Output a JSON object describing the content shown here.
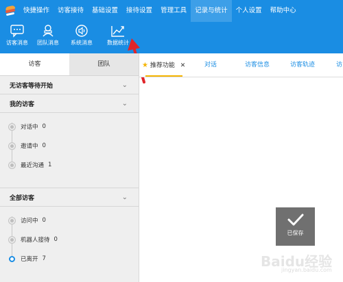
{
  "nav": {
    "items": [
      {
        "label": "快捷操作"
      },
      {
        "label": "访客接待"
      },
      {
        "label": "基础设置"
      },
      {
        "label": "接待设置"
      },
      {
        "label": "管理工具"
      },
      {
        "label": "记录与统计"
      },
      {
        "label": "个人设置"
      },
      {
        "label": "帮助中心"
      }
    ],
    "active_index": 5
  },
  "toolbar": {
    "items": [
      {
        "label": "访客消息",
        "icon": "chat-bubble-icon"
      },
      {
        "label": "团队消息",
        "icon": "team-icon"
      },
      {
        "label": "系统消息",
        "icon": "speaker-icon"
      },
      {
        "label": "数据统计",
        "icon": "trend-chart-icon"
      }
    ]
  },
  "left_panel": {
    "tabs": [
      {
        "label": "访客"
      },
      {
        "label": "团队"
      }
    ],
    "active_tab": 0,
    "sections": {
      "waiting": {
        "title": "无访客等待开始"
      },
      "mine": {
        "title": "我的访客",
        "items": [
          {
            "label": "对话中",
            "count": "0"
          },
          {
            "label": "邀请中",
            "count": "0"
          },
          {
            "label": "最近沟通",
            "count": "1"
          }
        ]
      },
      "all": {
        "title": "全部访客",
        "items": [
          {
            "label": "访问中",
            "count": "0"
          },
          {
            "label": "机器人接待",
            "count": "0"
          },
          {
            "label": "已离开",
            "count": "7"
          }
        ]
      }
    }
  },
  "right_tabs": {
    "pinned": {
      "label": "推荐功能"
    },
    "items": [
      {
        "label": "对话"
      },
      {
        "label": "访客信息"
      },
      {
        "label": "访客轨迹"
      },
      {
        "label": "访"
      }
    ]
  },
  "toast": {
    "text": "已保存"
  },
  "watermark": {
    "text": "Baidu经验",
    "sub": "jingyan.baidu.com"
  },
  "colors": {
    "primary": "#1a8de3",
    "highlight": "#f5b400",
    "arrow": "#e0252a"
  }
}
